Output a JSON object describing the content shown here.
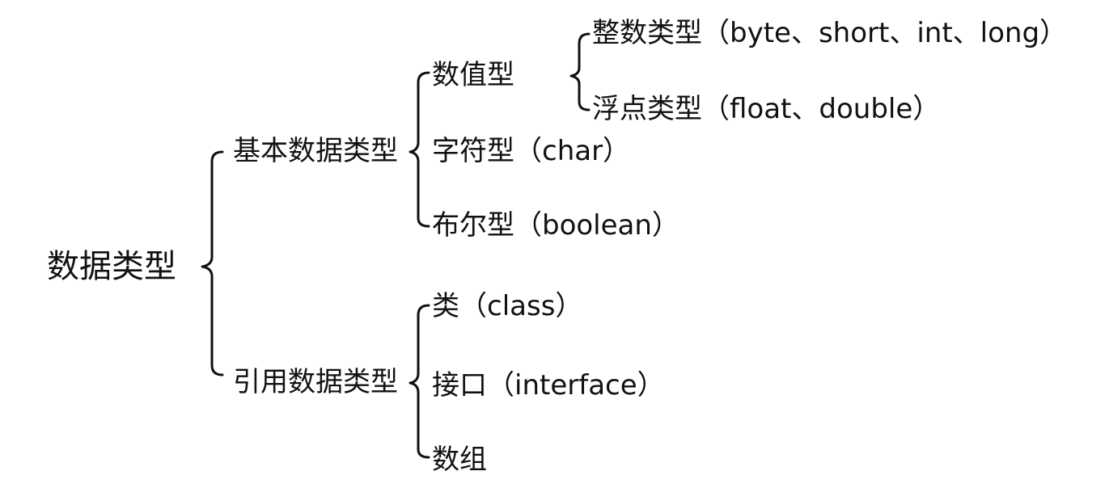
{
  "diagram": {
    "root": "数据类型",
    "primitive": {
      "label": "基本数据类型",
      "numeric": {
        "label": "数值型",
        "integer": "整数类型（byte、short、int、long）",
        "float": "浮点类型（float、double）"
      },
      "char": "字符型（char）",
      "boolean": "布尔型（boolean）"
    },
    "reference": {
      "label": "引用数据类型",
      "class": "类（class）",
      "interface": "接口（interface）",
      "array": "数组"
    }
  }
}
